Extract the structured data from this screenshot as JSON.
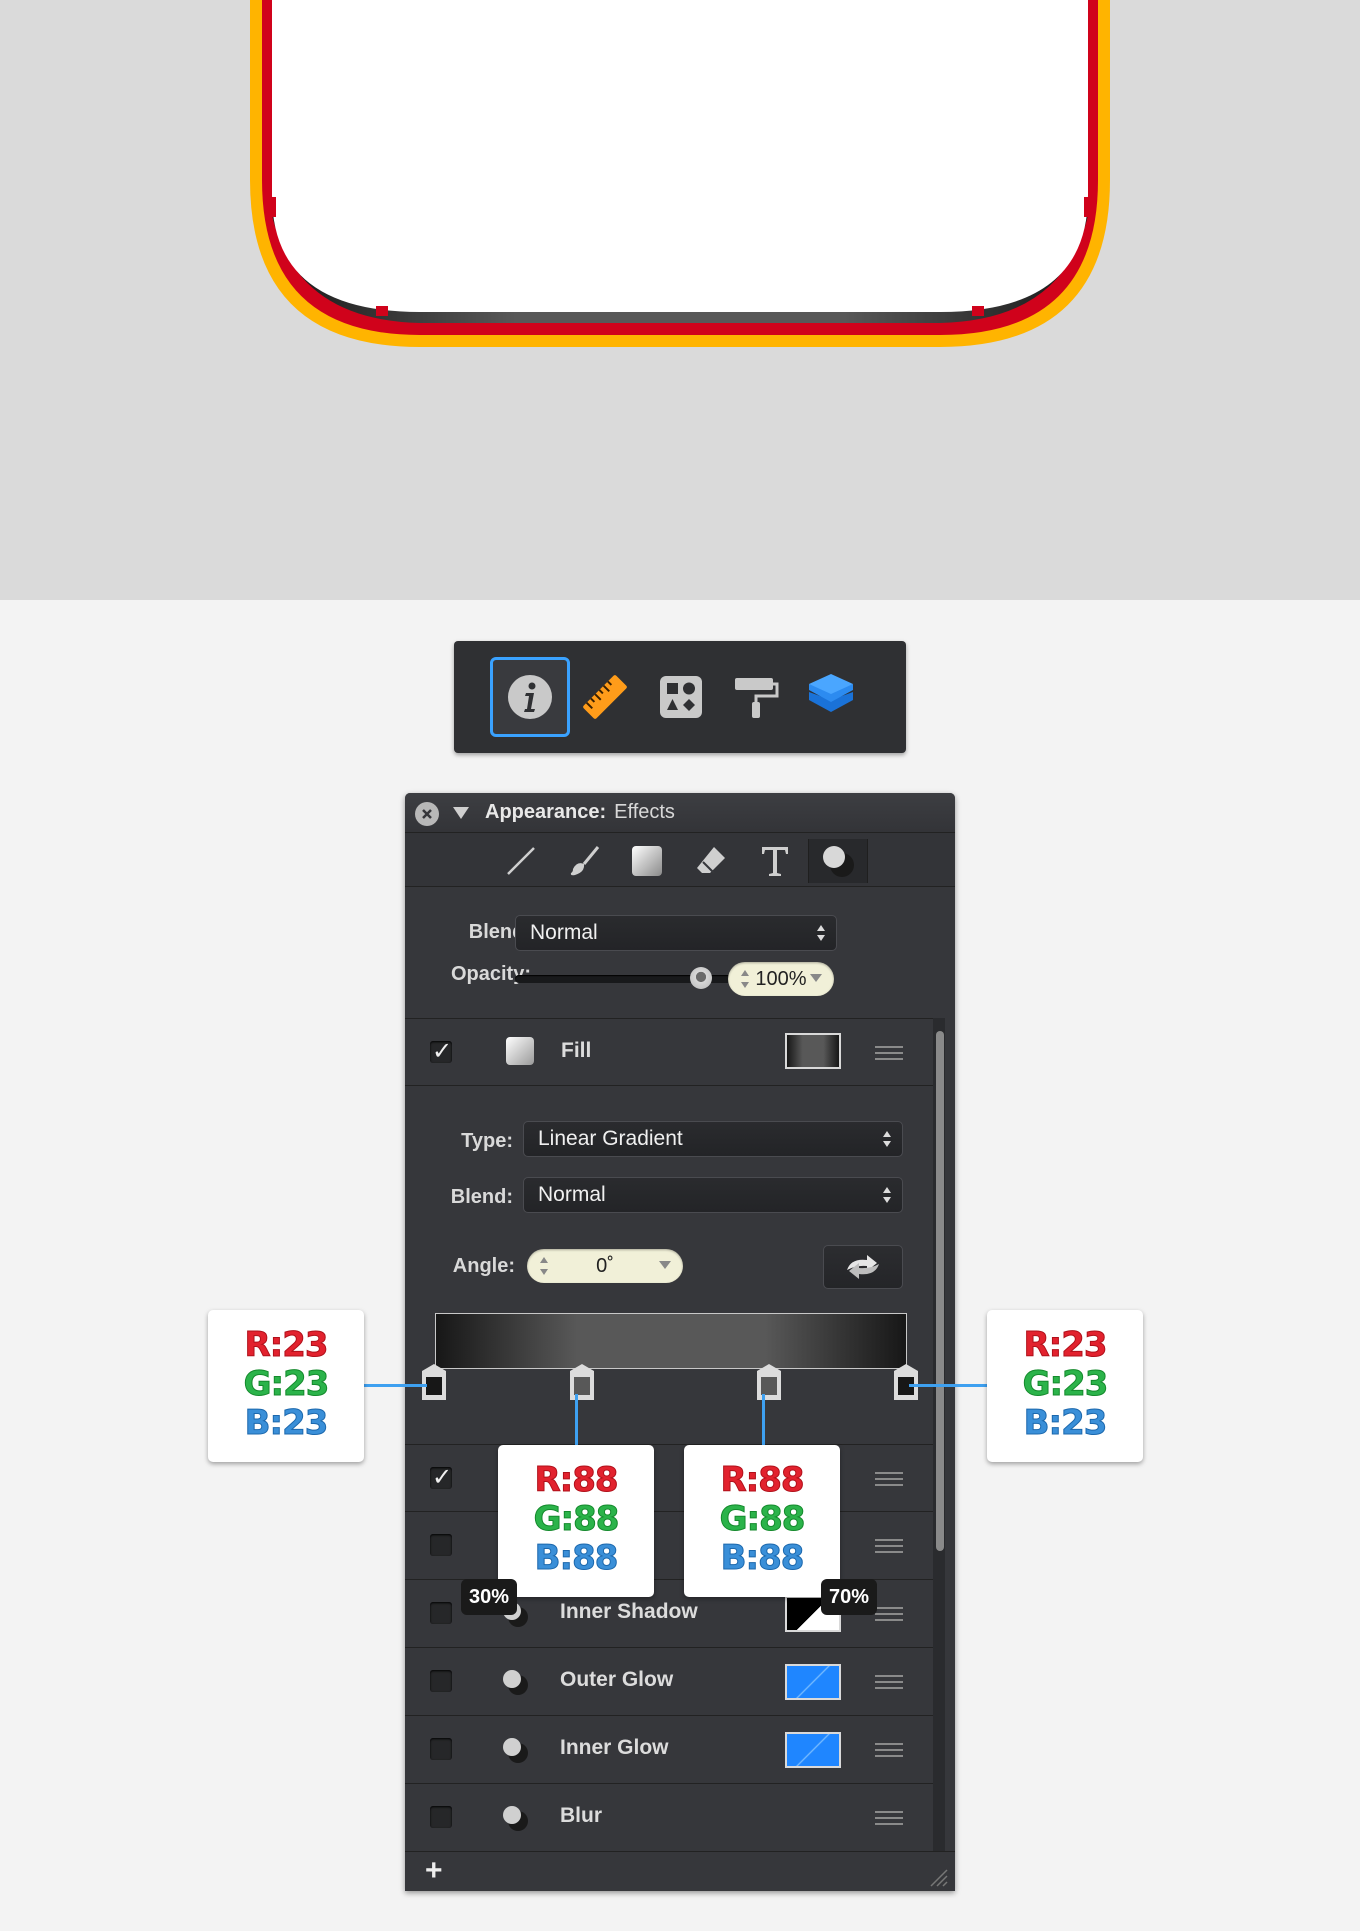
{
  "toolbar": {
    "items": [
      {
        "icon": "info-icon",
        "active": true
      },
      {
        "icon": "ruler-icon",
        "active": false
      },
      {
        "icon": "shapes-library-icon",
        "active": false
      },
      {
        "icon": "paint-roller-icon",
        "active": false
      },
      {
        "icon": "layers-icon",
        "active": false
      }
    ]
  },
  "panel": {
    "title": "Appearance:",
    "subtitle": "Effects",
    "tabs": [
      "stroke-icon",
      "brush-icon",
      "fill-icon",
      "eraser-icon",
      "text-icon",
      "effects-icon"
    ],
    "blend_label": "Blend:",
    "blend_value": "Normal",
    "opacity_label": "Opacity:",
    "opacity_value": "100%",
    "opacity_fraction": 1.0,
    "fill": {
      "checked": true,
      "name": "Fill",
      "type_label": "Type:",
      "type_value": "Linear Gradient",
      "blend_label": "Blend:",
      "blend_value": "Normal",
      "angle_label": "Angle:",
      "angle_value": "0˚",
      "gradient_stops": [
        {
          "position": 0,
          "color": "#171717"
        },
        {
          "position": 30,
          "color": "#585858"
        },
        {
          "position": 70,
          "color": "#585858"
        },
        {
          "position": 100,
          "color": "#171717"
        }
      ]
    },
    "effects": [
      {
        "name": "",
        "checked": true
      },
      {
        "name": "",
        "checked": false
      },
      {
        "name": "Inner Shadow",
        "checked": false,
        "swatch": "#000000"
      },
      {
        "name": "Outer Glow",
        "checked": false,
        "swatch": "#1f86ff"
      },
      {
        "name": "Inner Glow",
        "checked": false,
        "swatch": "#1f86ff"
      },
      {
        "name": "Blur",
        "checked": false
      }
    ],
    "add_label": "+"
  },
  "callouts": {
    "left": {
      "r": "R:23",
      "g": "G:23",
      "b": "B:23"
    },
    "right": {
      "r": "R:23",
      "g": "G:23",
      "b": "B:23"
    },
    "mid_left": {
      "r": "R:88",
      "g": "G:88",
      "b": "B:88",
      "percent": "30%"
    },
    "mid_right": {
      "r": "R:88",
      "g": "G:88",
      "b": "B:88",
      "percent": "70%"
    }
  },
  "colors": {
    "canvas_bg": "#dadada",
    "outer_stroke": "#ffb400",
    "inner_stroke": "#d0021b",
    "accent": "#3aa2ff"
  }
}
